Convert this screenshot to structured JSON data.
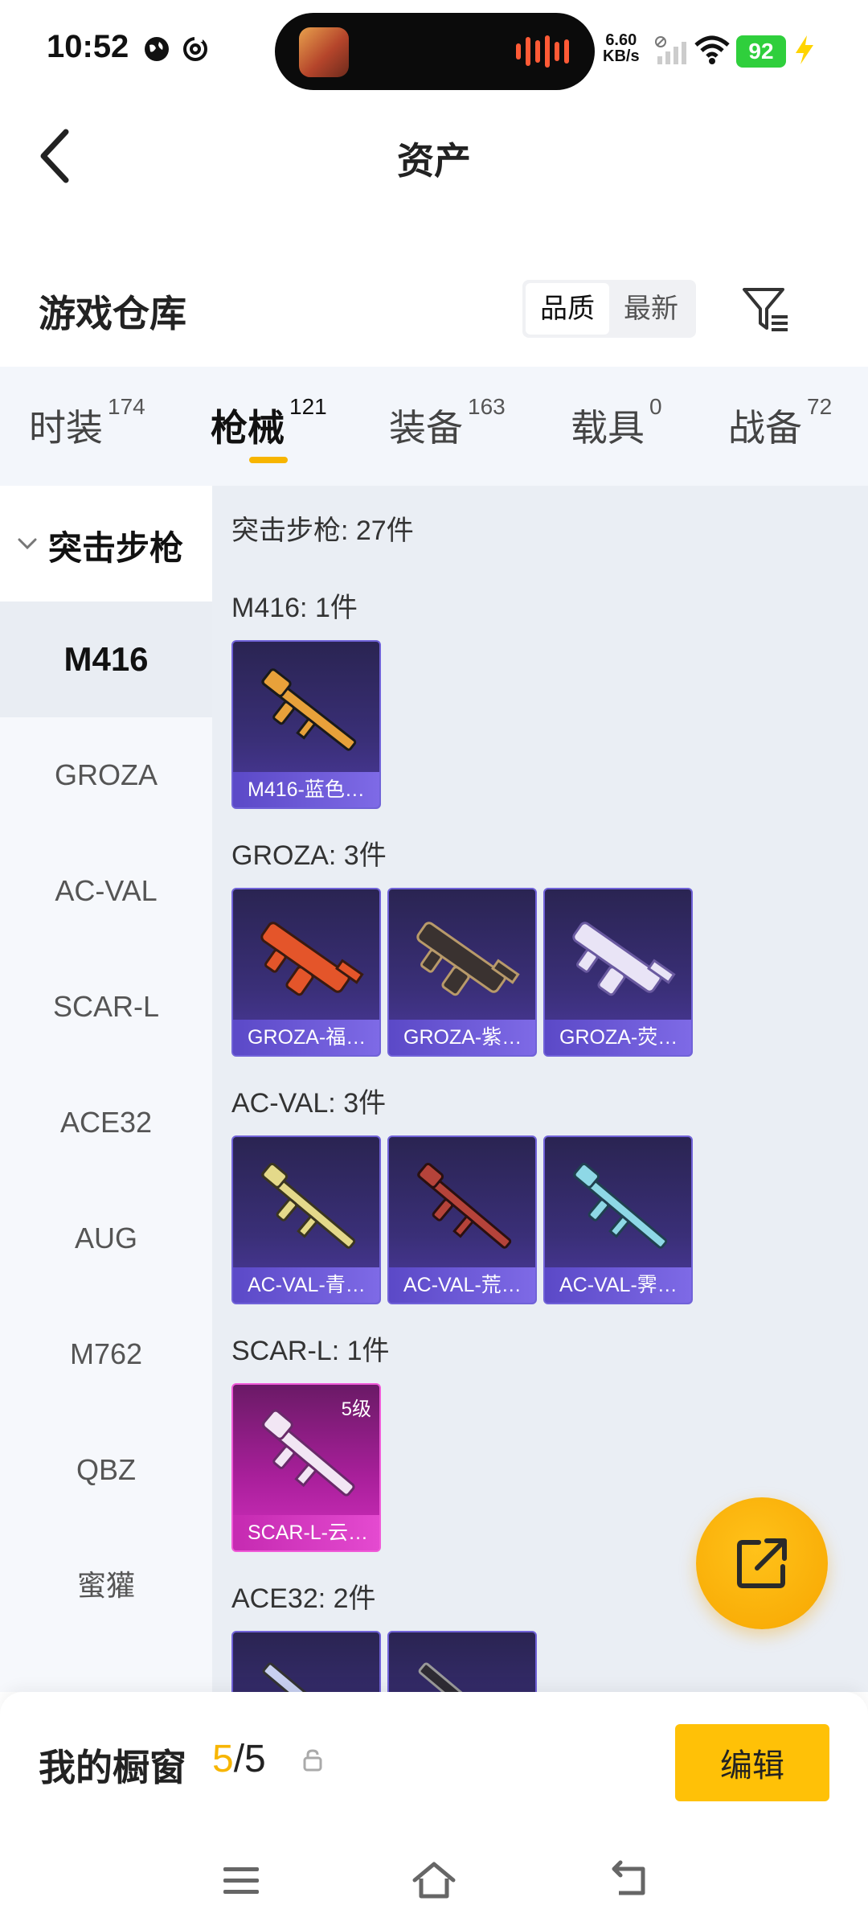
{
  "status_bar": {
    "time": "10:52",
    "net_speed_value": "6.60",
    "net_speed_unit": "KB/s",
    "battery": "92"
  },
  "header": {
    "title": "资产",
    "back_icon": "chevron-left-icon"
  },
  "section": {
    "title": "游戏仓库",
    "sort_options": [
      "品质",
      "最新"
    ],
    "sort_selected": "品质",
    "filter_icon": "filter-icon"
  },
  "tabs": [
    {
      "label": "时装",
      "count": "174"
    },
    {
      "label": "枪械",
      "count": "121",
      "active": true
    },
    {
      "label": "装备",
      "count": "163"
    },
    {
      "label": "载具",
      "count": "0"
    },
    {
      "label": "战备",
      "count": "72"
    }
  ],
  "sidebar": {
    "category": "突击步枪",
    "items": [
      "M416",
      "GROZA",
      "AC-VAL",
      "SCAR-L",
      "ACE32",
      "AUG",
      "M762",
      "QBZ",
      "蜜獾"
    ],
    "active": "M416"
  },
  "content": {
    "summary": "突击步枪: 27件",
    "groups": [
      {
        "title": "M416: 1件",
        "cards": [
          {
            "name": "M416-蓝色…",
            "rarity": "purple",
            "color": "#e8a13a"
          }
        ]
      },
      {
        "title": "GROZA: 3件",
        "cards": [
          {
            "name": "GROZA-福…",
            "rarity": "purple",
            "color": "#e4552a"
          },
          {
            "name": "GROZA-紫…",
            "rarity": "purple",
            "color": "#3a3230"
          },
          {
            "name": "GROZA-荧…",
            "rarity": "purple",
            "color": "#e9e4f6"
          }
        ]
      },
      {
        "title": "AC-VAL: 3件",
        "cards": [
          {
            "name": "AC-VAL-青…",
            "rarity": "purple",
            "color": "#e4d98a"
          },
          {
            "name": "AC-VAL-荒…",
            "rarity": "purple",
            "color": "#b5433a"
          },
          {
            "name": "AC-VAL-霁…",
            "rarity": "purple",
            "color": "#8ed8e6"
          }
        ]
      },
      {
        "title": "SCAR-L: 1件",
        "cards": [
          {
            "name": "SCAR-L-云…",
            "rarity": "pink",
            "level": "5级",
            "color": "#f2e6f4"
          }
        ]
      },
      {
        "title": "ACE32: 2件",
        "cards": [
          {
            "name": "",
            "rarity": "purple",
            "color": "#c8d0f0"
          },
          {
            "name": "",
            "rarity": "purple",
            "color": "#2e2b33"
          }
        ]
      }
    ]
  },
  "fab": {
    "icon": "share-icon"
  },
  "showcase": {
    "label": "我的橱窗",
    "current": "5",
    "sep_total": "/5",
    "edit_label": "编辑"
  },
  "colors": {
    "accent": "#f7b500",
    "card_purple": "#4d3aa0",
    "card_pink": "#d22fbe"
  }
}
